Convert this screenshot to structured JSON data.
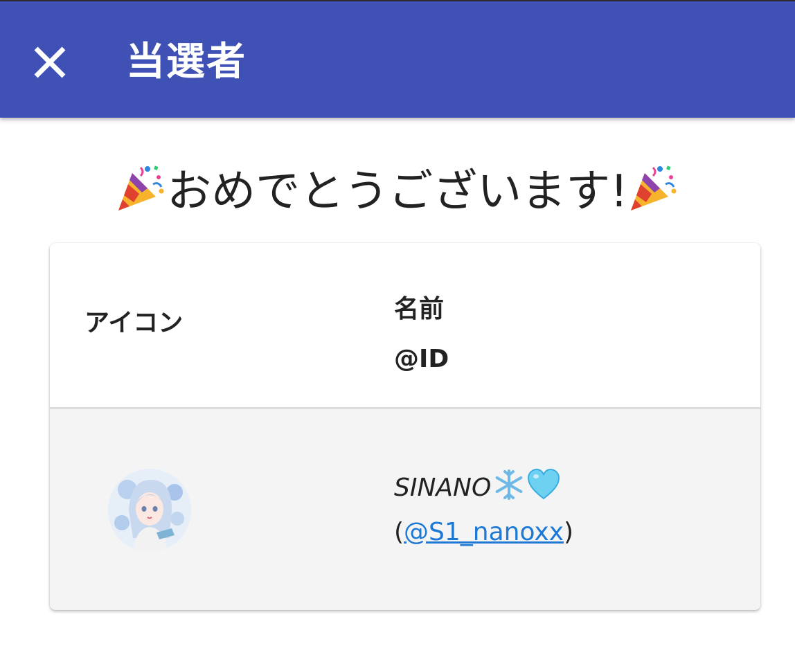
{
  "appbar": {
    "close_icon": "close-icon",
    "title": "当選者",
    "background_color": "#3f51b5"
  },
  "congrats": {
    "text": "おめでとうございます!",
    "decoration_icon": "party-popper-icon"
  },
  "table": {
    "headers": {
      "icon": "アイコン",
      "name": "名前",
      "id": "@ID"
    },
    "rows": [
      {
        "avatar": "avatar-image",
        "name": "SINANO",
        "name_emojis": [
          "snowflake-icon",
          "light-blue-heart-icon"
        ],
        "id_open": "(",
        "id": "@S1_nanoxx",
        "id_close": ")",
        "link_color": "#1e78d6"
      }
    ]
  }
}
